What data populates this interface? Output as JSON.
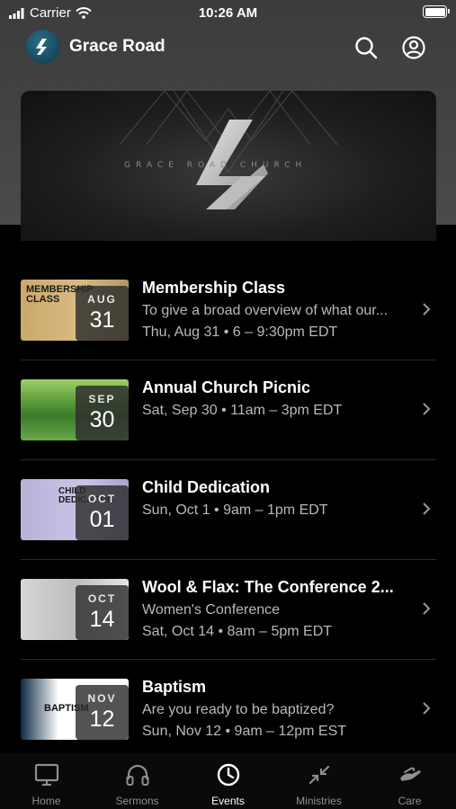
{
  "status_bar": {
    "carrier": "Carrier",
    "time": "10:26 AM"
  },
  "header": {
    "title": "Grace Road"
  },
  "banner": {
    "text": "GRACE ROAD CHURCH"
  },
  "events": [
    {
      "title": "Membership Class",
      "subtitle": "To give a broad overview of what our...",
      "when": "Thu, Aug 31 • 6 – 9:30pm EDT",
      "month": "AUG",
      "day": "31",
      "thumb_text": "MEMBERSHIP CLASS"
    },
    {
      "title": "Annual Church Picnic",
      "subtitle": "",
      "when": "Sat, Sep 30 • 11am – 3pm EDT",
      "month": "SEP",
      "day": "30"
    },
    {
      "title": "Child Dedication",
      "subtitle": "",
      "when": "Sun, Oct 1 • 9am – 1pm EDT",
      "month": "OCT",
      "day": "01",
      "thumb_text": "CHILD DEDICATION"
    },
    {
      "title": "Wool & Flax: The Conference 2...",
      "subtitle": "Women's Conference",
      "when": "Sat, Oct 14 • 8am – 5pm EDT",
      "month": "OCT",
      "day": "14"
    },
    {
      "title": "Baptism",
      "subtitle": "Are you ready to be baptized?",
      "when": "Sun, Nov 12 • 9am – 12pm EST",
      "month": "NOV",
      "day": "12",
      "thumb_text": "BAPTISM"
    }
  ],
  "tabs": [
    {
      "label": "Home",
      "icon": "tv-icon",
      "active": false
    },
    {
      "label": "Sermons",
      "icon": "headphones-icon",
      "active": false
    },
    {
      "label": "Events",
      "icon": "clock-icon",
      "active": true
    },
    {
      "label": "Ministries",
      "icon": "arrows-icon",
      "active": false
    },
    {
      "label": "Care",
      "icon": "hands-icon",
      "active": false
    }
  ],
  "colors": {
    "background": "#000000",
    "header_bg": "#434343",
    "text": "#ffffff",
    "muted_text": "#b9b9b9",
    "inactive_tab": "#8f8f8f"
  }
}
